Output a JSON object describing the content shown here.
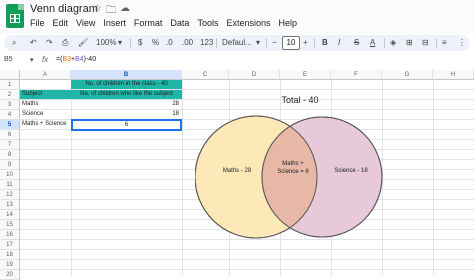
{
  "app": {
    "title": "Venn diagram",
    "menu": [
      "File",
      "Edit",
      "View",
      "Insert",
      "Format",
      "Data",
      "Tools",
      "Extensions",
      "Help"
    ]
  },
  "toolbar": {
    "zoom": "100%",
    "currency": "$",
    "percent": "%",
    "dec_decrease": ".0",
    "dec_increase": ".00",
    "number_format": "123",
    "font": "Defaul...",
    "font_size": "10",
    "minus": "−",
    "plus": "+",
    "bold": "B",
    "italic": "I",
    "strike": "S",
    "text_color": "A"
  },
  "formula_bar": {
    "cell_ref": "B5",
    "fx": "fx",
    "formula_prefix": "=(",
    "ref1": "B3",
    "plus": "+",
    "ref2": "B4",
    "formula_suffix": ")-40"
  },
  "columns": [
    "A",
    "B",
    "C",
    "D",
    "E",
    "F",
    "G",
    "H"
  ],
  "rows": [
    "1",
    "2",
    "3",
    "4",
    "5",
    "6",
    "7",
    "8",
    "9",
    "10",
    "11",
    "12",
    "13",
    "14",
    "15",
    "16",
    "17",
    "18",
    "19",
    "20"
  ],
  "cells": {
    "b1": "No. of children in the class - 40",
    "a2": "Subject",
    "b2": "No. of children who like the subject",
    "a3": "Maths",
    "b3": "28",
    "a4": "Science",
    "b4": "18",
    "a5": "Maths + Science",
    "b5": "6"
  },
  "venn": {
    "title": "Total - 40",
    "left_label": "Maths - 28",
    "overlap_label_1": "Maths +",
    "overlap_label_2": "Science = 6",
    "right_label": "Science - 18",
    "left_color": "#fde9b8",
    "right_color": "#e8c9d9",
    "overlap_color": "#e8b8a6"
  }
}
